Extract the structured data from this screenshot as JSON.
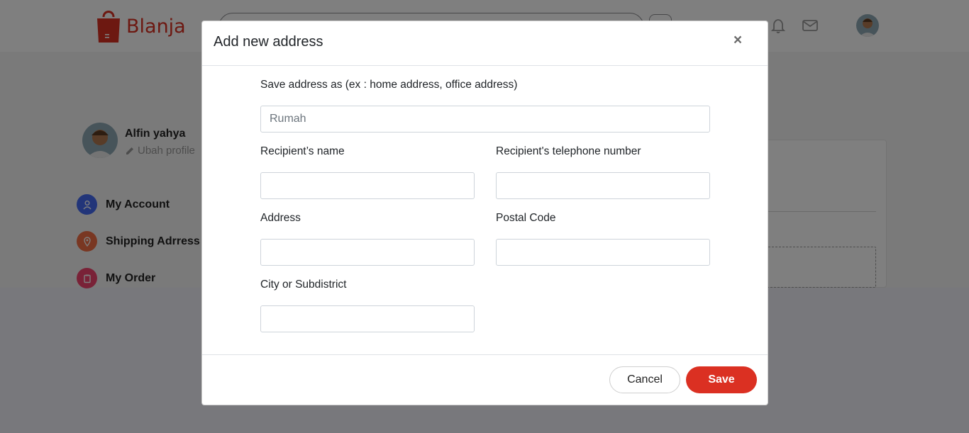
{
  "brand": {
    "name": "Blanja",
    "color": "#db3022"
  },
  "navbar": {
    "icons": [
      "search-icon",
      "filter-icon",
      "cart-icon",
      "bell-icon",
      "mail-icon",
      "user-avatar"
    ]
  },
  "profile": {
    "name": "Alfin yahya",
    "edit_label": "Ubah profile"
  },
  "sidebar": {
    "items": [
      {
        "label": "My Account",
        "icon": "user-icon",
        "color": "#456bf3"
      },
      {
        "label": "Shipping Adrress",
        "icon": "map-pin-icon",
        "color": "#f36f45"
      },
      {
        "label": "My Order",
        "icon": "clipboard-icon",
        "color": "#f3456f"
      }
    ]
  },
  "modal": {
    "title": "Add new address",
    "close_label": "×",
    "fields": {
      "save_as": {
        "label": "Save address as (ex : home address, office address)",
        "placeholder": "Rumah"
      },
      "recipient_name": {
        "label": "Recipient’s name",
        "placeholder": ""
      },
      "recipient_phone": {
        "label": "Recipient's telephone number",
        "placeholder": ""
      },
      "address": {
        "label": "Address",
        "placeholder": ""
      },
      "postal_code": {
        "label": "Postal Code",
        "placeholder": ""
      },
      "city": {
        "label": "City or Subdistrict",
        "placeholder": ""
      }
    },
    "cancel_label": "Cancel",
    "save_label": "Save"
  }
}
